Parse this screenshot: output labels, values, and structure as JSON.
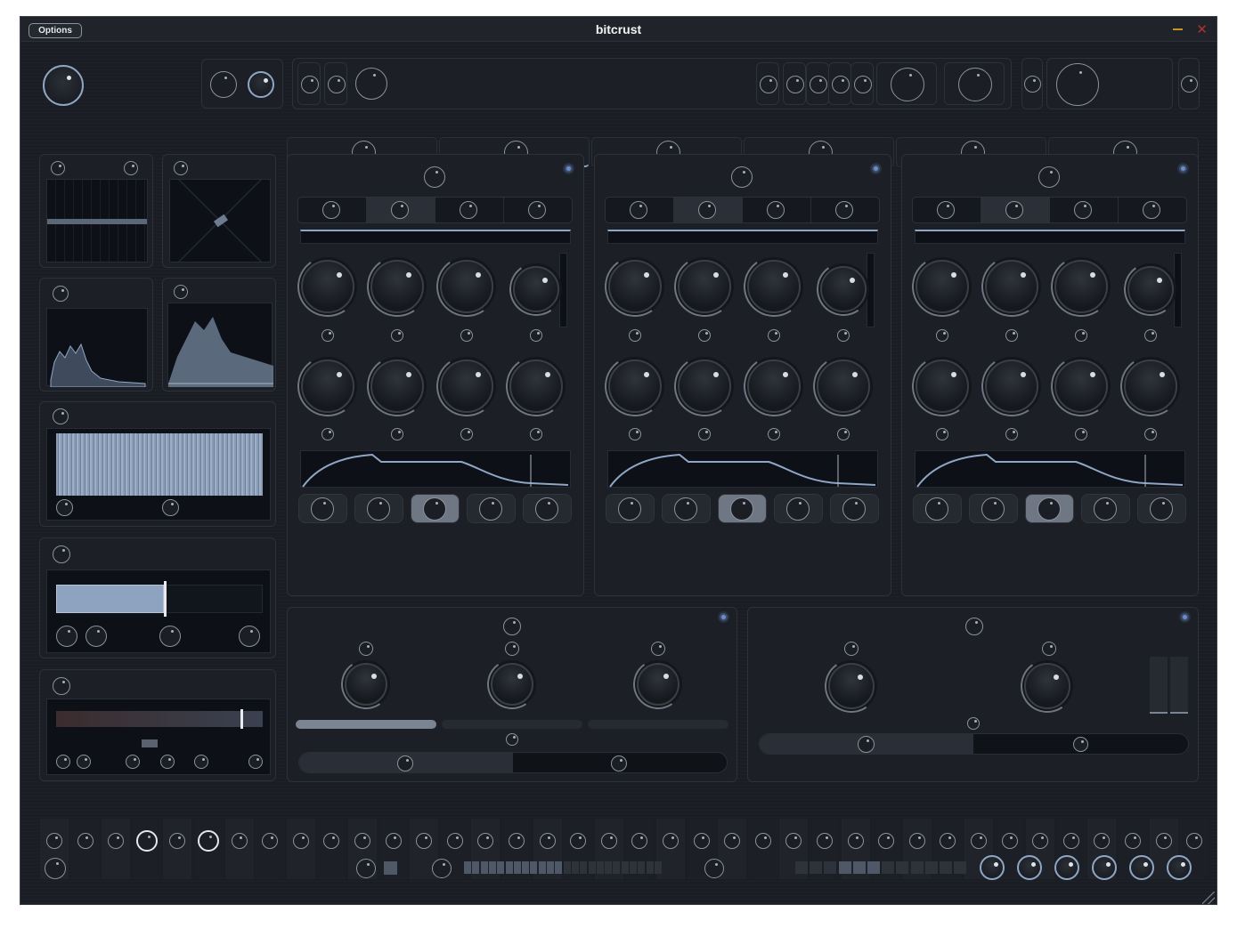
{
  "window": {
    "title": "bitcrust",
    "options_label": "Options"
  },
  "header": {
    "main_knob_icon": "knob-icon",
    "tabs": [
      {
        "icon": "tab-glyph-1",
        "active": false
      },
      {
        "icon": "tab-glyph-2",
        "active": true
      },
      {
        "icon": "tab-glyph-3",
        "active": false
      },
      {
        "icon": "tab-glyph-4",
        "active": false
      },
      {
        "icon": "tab-glyph-5",
        "active": false
      },
      {
        "icon": "tab-glyph-6",
        "active": false
      }
    ]
  },
  "oscillators": [
    {
      "enabled": true,
      "mode_selected": 1,
      "button_selected": 2
    },
    {
      "enabled": true,
      "mode_selected": 1,
      "button_selected": 2
    },
    {
      "enabled": true,
      "mode_selected": 1,
      "button_selected": 2
    }
  ],
  "filter_section": {
    "enabled": true,
    "slider_fill": 0.33
  },
  "output_section": {
    "enabled": true,
    "balance_fill": 0.5
  },
  "left_panels": {
    "ratio_slider_fill": 0.52,
    "mod_slider_position": 0.9
  },
  "bottom": {
    "step_count_a": 16,
    "active_step_a": 12,
    "step_count_b": 12,
    "active_steps_b": [
      3,
      4,
      5
    ]
  },
  "colors": {
    "accent": "#8fa6c4",
    "panel": "#1c1f26",
    "screen": "#0d1017",
    "led": "#6d8cc4",
    "minimize": "#c89426",
    "close": "#b2322d"
  }
}
